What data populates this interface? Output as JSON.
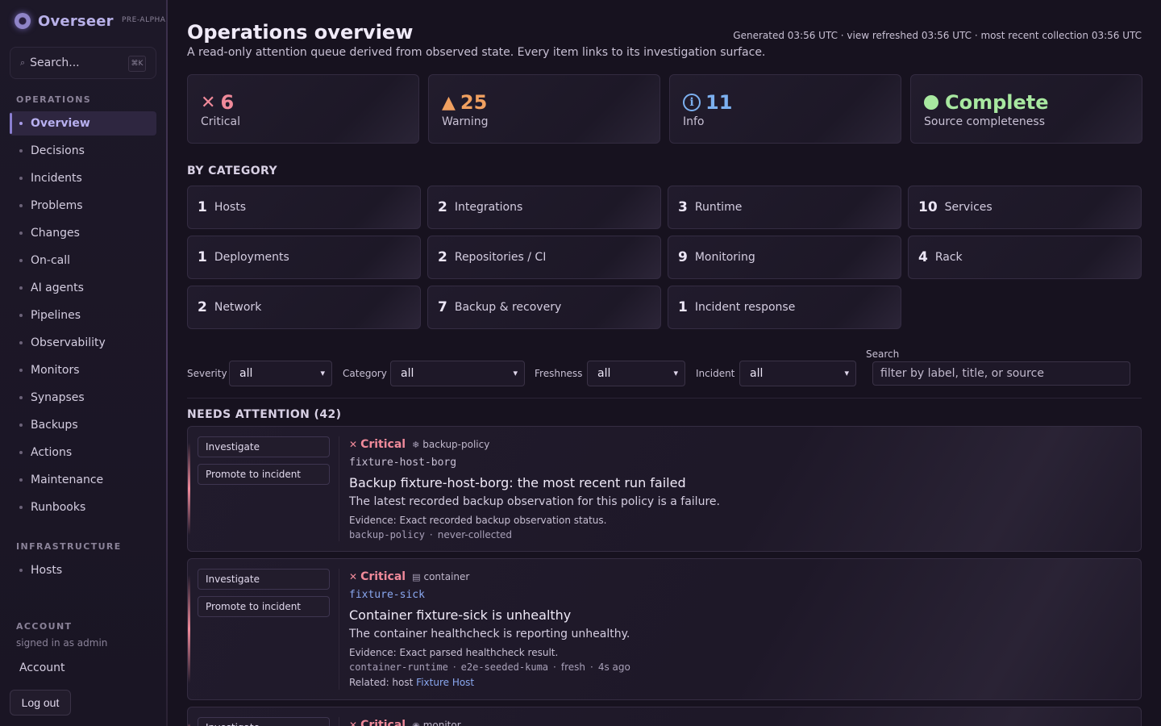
{
  "sidebar": {
    "brand": "Overseer",
    "badge": "PRE-ALPHA",
    "search_placeholder": "Search...",
    "search_kbd": "⌘K",
    "operations_title": "OPERATIONS",
    "operations_items": [
      "Overview",
      "Decisions",
      "Incidents",
      "Problems",
      "Changes",
      "On-call",
      "AI agents",
      "Pipelines",
      "Observability",
      "Monitors",
      "Synapses",
      "Backups",
      "Actions",
      "Maintenance",
      "Runbooks"
    ],
    "active_item": "Overview",
    "infrastructure_title": "INFRASTRUCTURE",
    "infrastructure_items": [
      "Hosts"
    ],
    "account_title": "ACCOUNT",
    "signed_in": "signed in as admin",
    "account_link": "Account",
    "logout": "Log out"
  },
  "header": {
    "title": "Operations overview",
    "subtitle": "A read-only attention queue derived from observed state. Every item links to its investigation surface.",
    "generated": "Generated 03:56 UTC · view refreshed 03:56 UTC · most recent collection 03:56 UTC"
  },
  "stats": [
    {
      "symbol": "✕",
      "value": "6",
      "label": "Critical",
      "tone": "crit"
    },
    {
      "symbol": "▲",
      "value": "25",
      "label": "Warning",
      "tone": "warn"
    },
    {
      "symbol": "i",
      "value": "11",
      "label": "Info",
      "tone": "info"
    },
    {
      "symbol": "●",
      "value": "Complete",
      "label": "Source completeness",
      "tone": "ok"
    }
  ],
  "by_category_title": "BY CATEGORY",
  "categories": [
    {
      "count": "1",
      "label": "Hosts"
    },
    {
      "count": "2",
      "label": "Integrations"
    },
    {
      "count": "3",
      "label": "Runtime"
    },
    {
      "count": "10",
      "label": "Services"
    },
    {
      "count": "1",
      "label": "Deployments"
    },
    {
      "count": "2",
      "label": "Repositories / CI"
    },
    {
      "count": "9",
      "label": "Monitoring"
    },
    {
      "count": "4",
      "label": "Rack"
    },
    {
      "count": "2",
      "label": "Network"
    },
    {
      "count": "7",
      "label": "Backup & recovery"
    },
    {
      "count": "1",
      "label": "Incident response"
    }
  ],
  "filters": {
    "severity_label": "Severity",
    "severity_value": "all",
    "category_label": "Category",
    "category_value": "all",
    "freshness_label": "Freshness",
    "freshness_value": "all",
    "incident_label": "Incident",
    "incident_value": "all",
    "search_label": "Search",
    "search_placeholder": "filter by label, title, or source"
  },
  "needs_attention_title": "NEEDS ATTENTION (42)",
  "items": [
    {
      "investigate": "Investigate",
      "promote": "Promote to incident",
      "severity": "Critical",
      "source_icon": "backup-icon",
      "source": "backup-policy",
      "entity": "fixture-host-borg",
      "title": "Backup fixture-host-borg: the most recent run failed",
      "description": "The latest recorded backup observation for this policy is a failure.",
      "evidence_label": "Evidence:",
      "evidence": "Exact recorded backup observation status.",
      "meta_source": "backup-policy",
      "meta_freshness": "never-collected"
    },
    {
      "investigate": "Investigate",
      "promote": "Promote to incident",
      "severity": "Critical",
      "source_icon": "container-icon",
      "source": "container",
      "entity": "fixture-sick",
      "title": "Container fixture-sick is unhealthy",
      "description": "The container healthcheck is reporting unhealthy.",
      "evidence_label": "Evidence:",
      "evidence": "Exact parsed healthcheck result.",
      "meta_source": "container-runtime",
      "meta_collector": "e2e-seeded-kuma",
      "meta_freshness": "fresh",
      "meta_age": "4s ago",
      "related_label": "Related: host",
      "related_link": "Fixture Host"
    },
    {
      "investigate": "Investigate",
      "severity": "Critical",
      "source_icon": "monitor-icon",
      "source": "monitor"
    }
  ]
}
